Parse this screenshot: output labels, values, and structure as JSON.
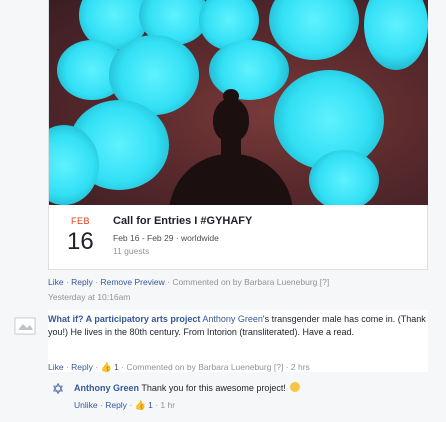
{
  "event": {
    "month": "FEB",
    "day": "16",
    "title": "Call for Entries I #GYHAFY",
    "dates": "Feb 16 - Feb 29 · worldwide",
    "guests": "11 guests"
  },
  "post_actions": {
    "like": "Like",
    "reply": "Reply",
    "remove_preview": "Remove Preview",
    "commented_on_by": "Commented on by",
    "author": "Barbara Lueneburg",
    "badge": "[?]",
    "timestamp": "Yesterday at 10:16am"
  },
  "comment1": {
    "page_name": "What if? A participatory arts project",
    "mention": "Anthony Green",
    "text_after_mention": "'s transgender male has come in. (Thank you!) He lives in the 80th century. From Intorion (transliterated). Have a read.",
    "like": "Like",
    "reply": "Reply",
    "likes": "1",
    "commented_on_by": "Commented on by",
    "author": "Barbara Lueneburg",
    "badge": "[?]",
    "time": "2 hrs"
  },
  "reply1": {
    "author": "Anthony Green",
    "text": "Thank you for this awesome project!",
    "unlike": "Unlike",
    "reply": "Reply",
    "likes": "1",
    "time": "1 hr"
  },
  "icons": {
    "page_avatar": "page-avatar-icon",
    "star_of_david": "star-of-david-icon",
    "thumbs_up": "thumbs-up-icon",
    "smiley": "smiley-emoji-icon"
  },
  "colors": {
    "link": "#365899",
    "date_month": "#dd3c10",
    "meta_gray": "#90949c",
    "photo_blob": "#33e0f5"
  }
}
